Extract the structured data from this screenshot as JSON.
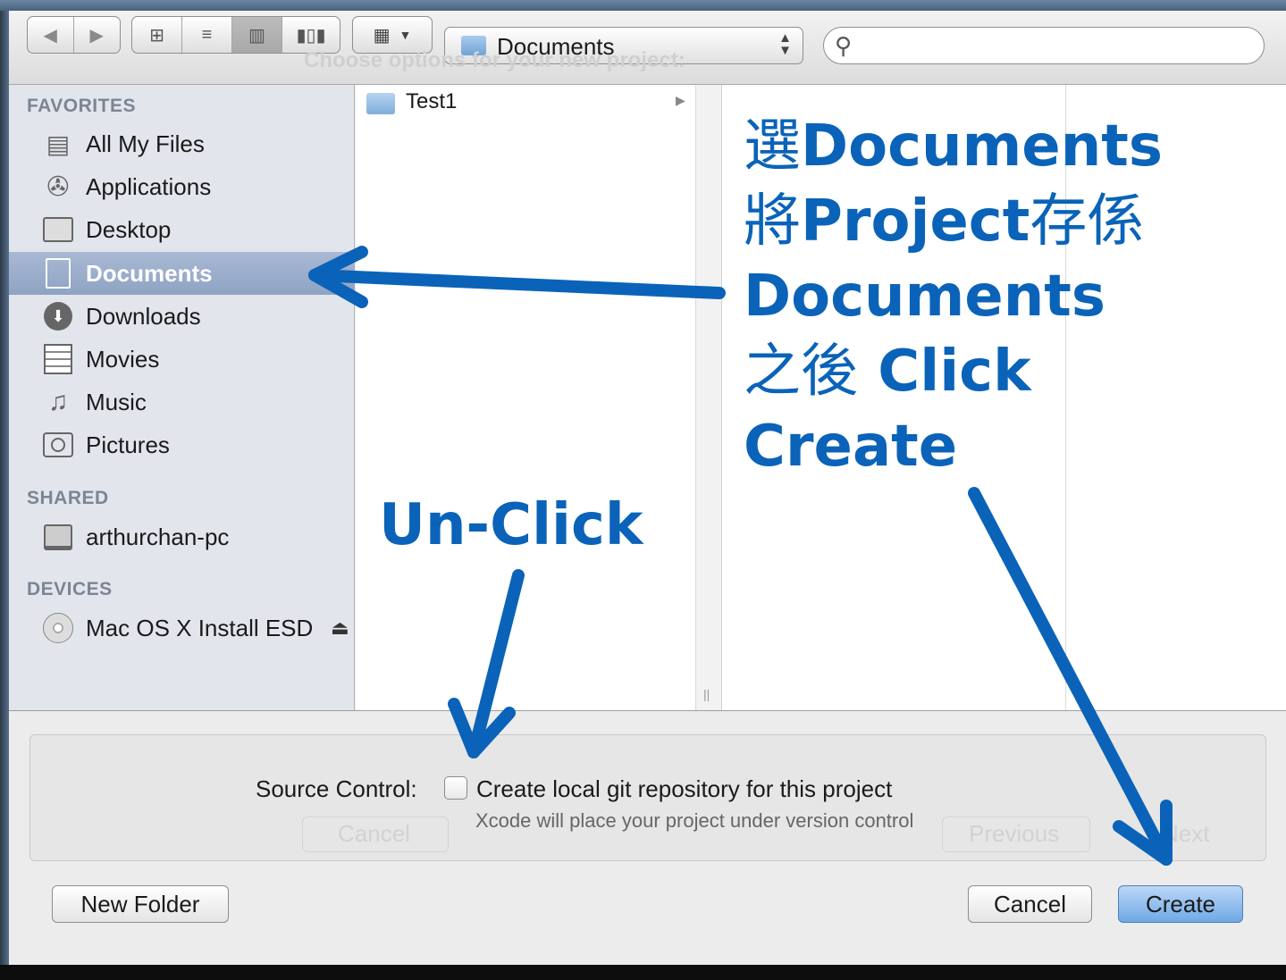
{
  "toolbar": {
    "location": "Documents",
    "search_placeholder": "",
    "ghost_prompt": "Choose options for your new project:"
  },
  "sidebar": {
    "favorites_header": "FAVORITES",
    "favorites": [
      {
        "label": "All My Files",
        "icon": "all-files-icon"
      },
      {
        "label": "Applications",
        "icon": "applications-icon"
      },
      {
        "label": "Desktop",
        "icon": "desktop-icon"
      },
      {
        "label": "Documents",
        "icon": "documents-icon",
        "selected": true
      },
      {
        "label": "Downloads",
        "icon": "downloads-icon"
      },
      {
        "label": "Movies",
        "icon": "movies-icon"
      },
      {
        "label": "Music",
        "icon": "music-icon"
      },
      {
        "label": "Pictures",
        "icon": "pictures-icon"
      }
    ],
    "shared_header": "SHARED",
    "shared": [
      {
        "label": "arthurchan-pc",
        "icon": "computer-icon"
      }
    ],
    "devices_header": "DEVICES",
    "devices": [
      {
        "label": "Mac OS X Install ESD",
        "icon": "disc-icon"
      }
    ]
  },
  "browser": {
    "items": [
      {
        "label": "Test1",
        "icon": "folder-icon"
      }
    ]
  },
  "options": {
    "source_control_label": "Source Control:",
    "checkbox_label": "Create local git repository for this project",
    "checkbox_checked": false,
    "hint": "Xcode will place your project under version control",
    "ghost_cancel": "Cancel",
    "ghost_previous": "Previous",
    "ghost_next": "Next"
  },
  "buttons": {
    "new_folder": "New Folder",
    "cancel": "Cancel",
    "create": "Create"
  },
  "annotations": {
    "line1_cjk": "選",
    "line1_en": "Documents",
    "line2_cjk": "將",
    "line2_en": "Project",
    "line2_cjk2": "存係",
    "line3": "Documents",
    "line4_cjk": "之後",
    "line4_en": "Click",
    "line5": "Create",
    "unclick": "Un-Click",
    "color": "#0a63b8"
  }
}
